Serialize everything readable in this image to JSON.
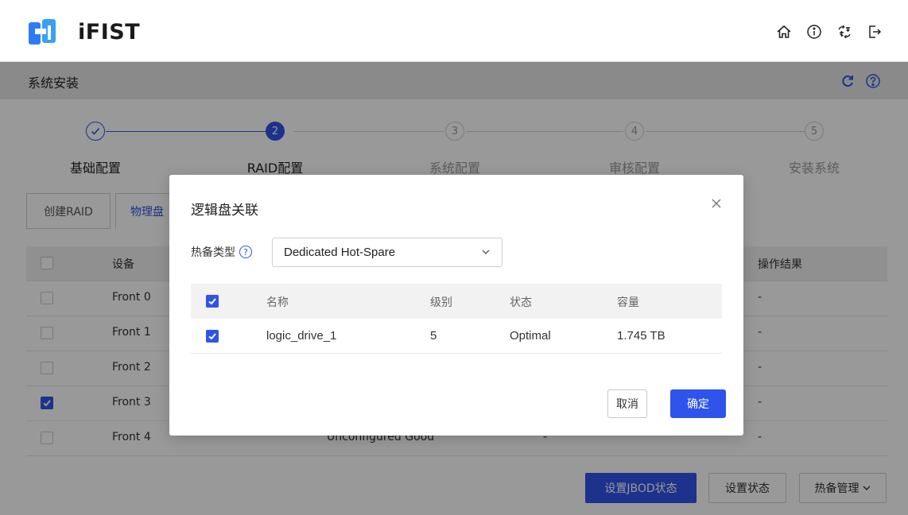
{
  "app": {
    "name": "iFIST"
  },
  "breadcrumb": {
    "title": "系统安装"
  },
  "steps": [
    {
      "number": "",
      "label": "基础配置",
      "state": "done"
    },
    {
      "number": "2",
      "label": "RAID配置",
      "state": "active"
    },
    {
      "number": "3",
      "label": "系统配置",
      "state": "pending"
    },
    {
      "number": "4",
      "label": "审核配置",
      "state": "pending"
    },
    {
      "number": "5",
      "label": "安装系统",
      "state": "pending"
    }
  ],
  "tabs": {
    "create_raid": "创建RAID",
    "physical_disk": "物理盘"
  },
  "bg_table": {
    "header": {
      "device": "设备",
      "result": "操作结果"
    },
    "rows": [
      {
        "device": "Front 0",
        "checked": false,
        "status": "",
        "col3": "",
        "result": "-"
      },
      {
        "device": "Front 1",
        "checked": false,
        "status": "",
        "col3": "",
        "result": "-"
      },
      {
        "device": "Front 2",
        "checked": false,
        "status": "",
        "col3": "",
        "result": "-"
      },
      {
        "device": "Front 3",
        "checked": true,
        "status": "",
        "col3": "",
        "result": "-"
      },
      {
        "device": "Front 4",
        "checked": false,
        "status": "Unconfigured Good",
        "col3": "-",
        "result": "-"
      }
    ]
  },
  "bottom_buttons": {
    "set_jbod": "设置JBOD状态",
    "set_state": "设置状态",
    "hotspare_mgmt": "热备管理"
  },
  "modal": {
    "title": "逻辑盘关联",
    "hotspare_label": "热备类型",
    "hotspare_value": "Dedicated Hot-Spare",
    "columns": {
      "name": "名称",
      "level": "级别",
      "state": "状态",
      "capacity": "容量"
    },
    "rows": [
      {
        "name": "logic_drive_1",
        "level": "5",
        "state": "Optimal",
        "capacity": "1.745 TB",
        "checked": true
      }
    ],
    "cancel": "取消",
    "confirm": "确定"
  },
  "colors": {
    "accent": "#2f54eb"
  }
}
